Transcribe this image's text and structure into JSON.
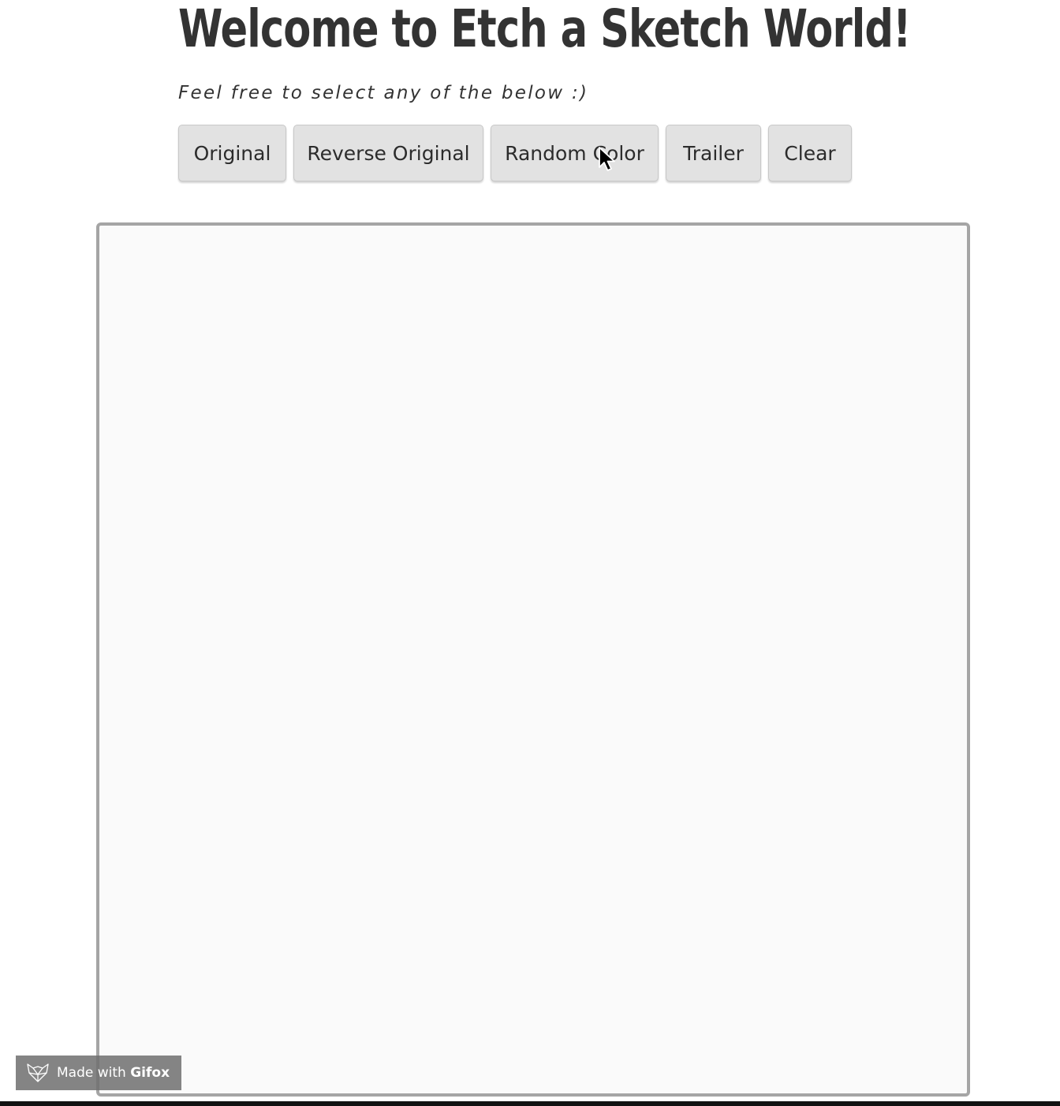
{
  "header": {
    "title": "Welcome to Etch a Sketch World!",
    "subtitle": "Feel free to select any of the below :)"
  },
  "buttons": {
    "original": "Original",
    "reverse_original": "Reverse Original",
    "random_color": "Random Color",
    "trailer": "Trailer",
    "clear": "Clear"
  },
  "badge": {
    "prefix": "Made with ",
    "brand": "Gifox",
    "icon": "fox-logo-icon"
  },
  "colors": {
    "text": "#333333",
    "button_bg": "#e2e2e2",
    "canvas_bg": "#fafafa",
    "canvas_border": "#a5a5a5"
  }
}
